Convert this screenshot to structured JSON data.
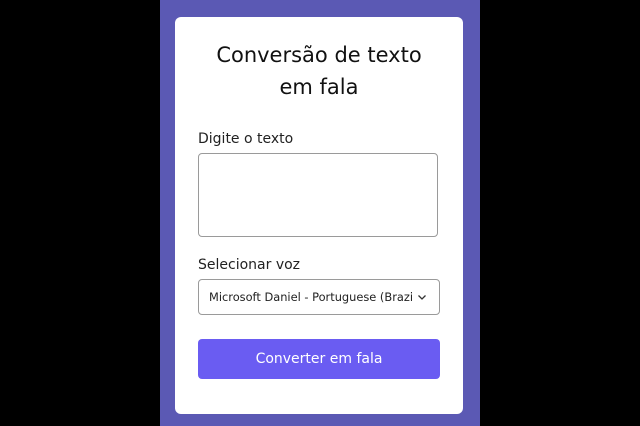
{
  "form": {
    "title_line1": "Conversão de texto",
    "title_line2": "em fala",
    "text_label": "Digite o texto",
    "text_value": "",
    "voice_label": "Selecionar voz",
    "voice_selected": "Microsoft Daniel - Portuguese (Brazil) (",
    "submit_label": "Converter em fala"
  },
  "colors": {
    "background_panel": "#5b59b4",
    "button": "#6a5cf2"
  },
  "icons": {
    "select_arrow": "chevron-down-icon"
  }
}
